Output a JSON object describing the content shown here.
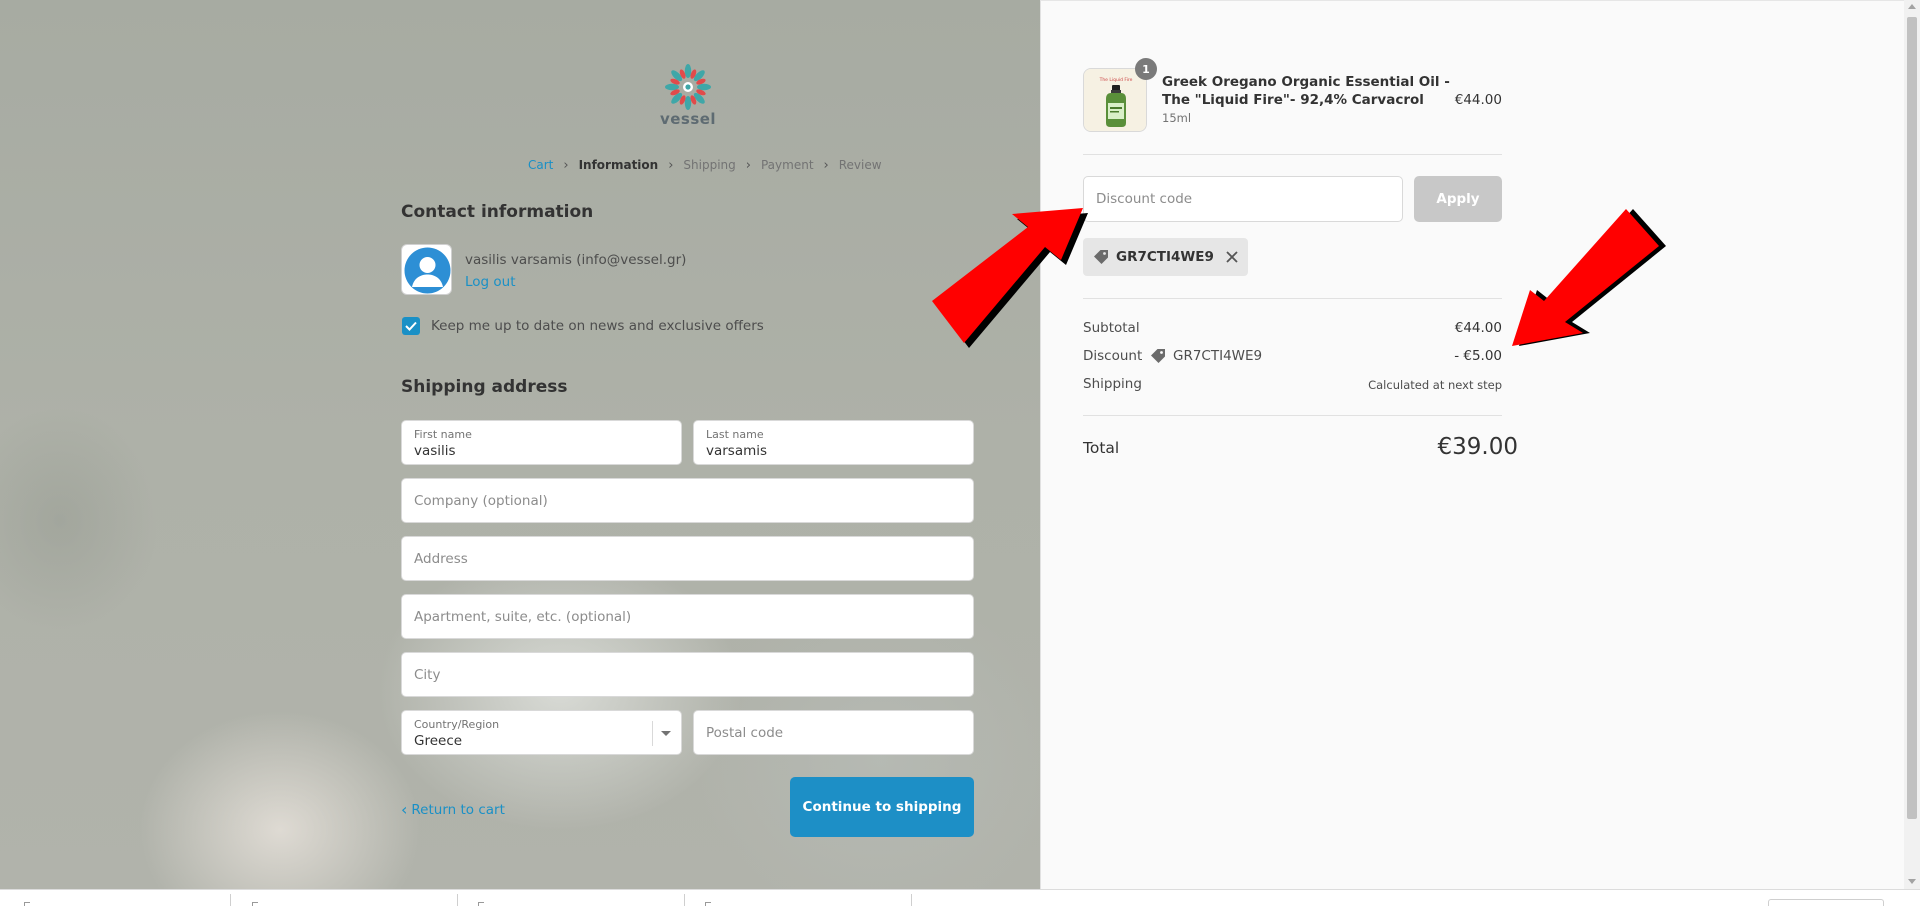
{
  "brand": {
    "name": "vessel",
    "colors": {
      "accent": "#1a90c6",
      "primary_button": "#1d8fc6",
      "logo_teal": "#3fa7a8",
      "logo_red": "#e14b4b"
    }
  },
  "breadcrumb": {
    "items": [
      {
        "label": "Cart",
        "state": "link"
      },
      {
        "label": "Information",
        "state": "current"
      },
      {
        "label": "Shipping",
        "state": "upcoming"
      },
      {
        "label": "Payment",
        "state": "upcoming"
      },
      {
        "label": "Review",
        "state": "upcoming"
      }
    ]
  },
  "contact": {
    "title": "Contact information",
    "user": "vasilis varsamis (info@vessel.gr)",
    "logout_label": "Log out",
    "newsletter_label": "Keep me up to date on news and exclusive offers",
    "newsletter_checked": true
  },
  "shipping": {
    "title": "Shipping address",
    "first_name": {
      "label": "First name",
      "value": "vasilis"
    },
    "last_name": {
      "label": "Last name",
      "value": "varsamis"
    },
    "company": {
      "placeholder": "Company (optional)"
    },
    "address": {
      "placeholder": "Address"
    },
    "apartment": {
      "placeholder": "Apartment, suite, etc. (optional)"
    },
    "city": {
      "placeholder": "City"
    },
    "country": {
      "label": "Country/Region",
      "value": "Greece"
    },
    "postal": {
      "placeholder": "Postal code"
    }
  },
  "actions": {
    "return_label": "Return to cart",
    "continue_label": "Continue to shipping"
  },
  "order": {
    "product": {
      "name": "Greek Oregano Organic Essential Oil -The \"Liquid Fire\"- 92,4% Carvacrol",
      "variant": "15ml",
      "price": "€44.00",
      "quantity": "1",
      "thumb_label": "The Liquid Fire"
    },
    "discount": {
      "placeholder": "Discount code",
      "apply_label": "Apply",
      "applied_code": "GR7CTI4WE9"
    },
    "summary": {
      "subtotal_label": "Subtotal",
      "subtotal_value": "€44.00",
      "discount_label": "Discount",
      "discount_code": "GR7CTI4WE9",
      "discount_value": "- €5.00",
      "shipping_label": "Shipping",
      "shipping_value": "Calculated at next step",
      "total_label": "Total",
      "total_value": "€39.00"
    }
  },
  "annotations": {
    "arrow_color": "#ff0000",
    "arrow_shadow": "#000000"
  }
}
